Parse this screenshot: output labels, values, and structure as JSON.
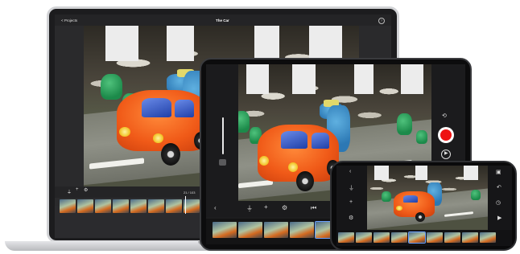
{
  "laptop": {
    "back_label": "< Projects",
    "title": "The Car",
    "frame_counter": "21 / 103",
    "toolbar_icons": [
      "mic-icon",
      "plus-icon",
      "settings-icon"
    ]
  },
  "tablet": {
    "side_icons": [
      "camera-switch-icon",
      "record-icon",
      "play-icon"
    ],
    "toolbar_icons": [
      "chevron-left-icon",
      "mic-icon",
      "plus-icon",
      "settings-icon",
      "skip-back-icon"
    ]
  },
  "phone": {
    "left_icons": [
      "chevron-left-icon",
      "mic-icon",
      "plus-icon",
      "settings-icon"
    ],
    "right_icons": [
      "camera-icon",
      "undo-icon",
      "timer-icon",
      "play-icon"
    ]
  },
  "colors": {
    "record": "#ee1111",
    "car": "#f05a18",
    "device_dark": "#1c1c1e",
    "laptop_silver": "#d2d3d6"
  }
}
